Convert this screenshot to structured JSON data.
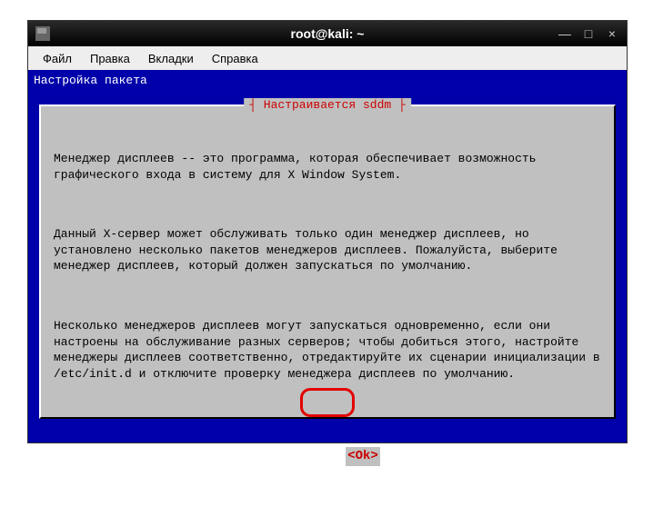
{
  "window": {
    "title": "root@kali: ~",
    "controls": {
      "minimize": "—",
      "maximize": "□",
      "close": "×"
    }
  },
  "menubar": {
    "file": "Файл",
    "edit": "Правка",
    "tabs": "Вкладки",
    "help": "Справка"
  },
  "terminal": {
    "header": "Настройка пакета"
  },
  "dialog": {
    "title": "┤ Настраивается sddm ├",
    "para1": "Менеджер дисплеев -- это программа, которая обеспечивает возможность графического входа в систему для X Window System.",
    "para2": "Данный X-сервер может обслуживать только один менеджер дисплеев, но установлено несколько пакетов менеджеров дисплеев. Пожалуйста, выберите менеджер дисплеев, который должен запускаться по умолчанию.",
    "para3": "Несколько менеджеров дисплеев могут запускаться одновременно, если они настроены на обслуживание разных серверов; чтобы добиться этого, настройте менеджеры дисплеев соответственно, отредактируйте их сценарии инициализации в /etc/init.d и отключите проверку менеджера дисплеев по умолчанию.",
    "ok": "<Ok>"
  }
}
